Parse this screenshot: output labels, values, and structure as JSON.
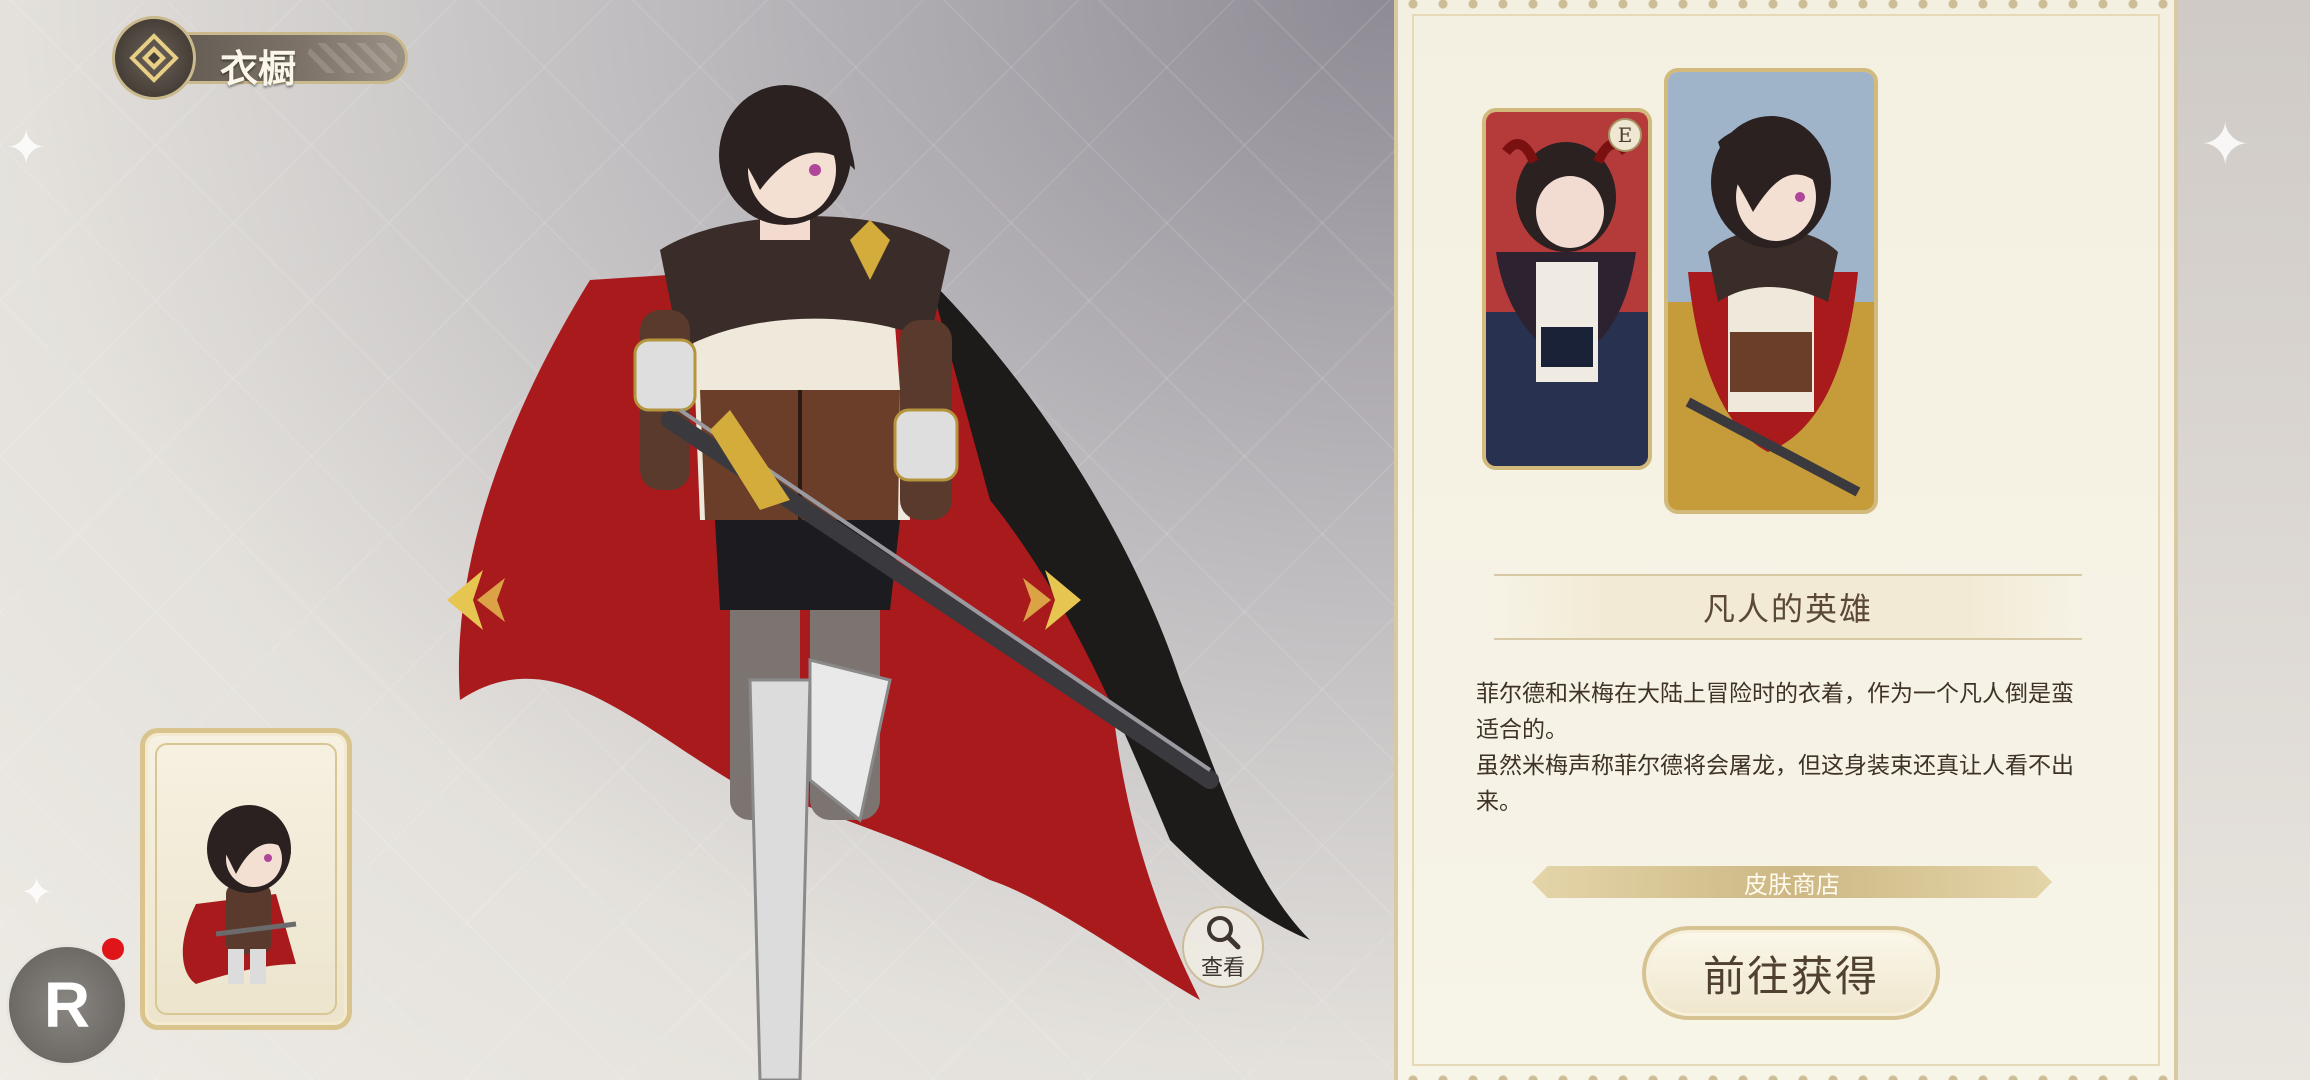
{
  "header": {
    "title": "衣橱"
  },
  "viewer": {
    "view_label": "查看"
  },
  "skin": {
    "badge": "E",
    "name": "凡人的英雄",
    "description_lines": [
      "菲尔德和米梅在大陆上冒险时的衣着，作为一个凡人倒是蛮",
      "适合的。",
      "虽然米梅声称菲尔德将会屠龙，但这身装束还真让人看不出",
      "来。"
    ],
    "shop_label": "皮肤商店",
    "go_button": "前往获得"
  },
  "overlay": {
    "r_button": "R"
  },
  "colors": {
    "gold": "#d2b97c",
    "panel": "#f4f0e1",
    "cape_red": "#a81a1c",
    "notification_red": "#e0151a"
  }
}
